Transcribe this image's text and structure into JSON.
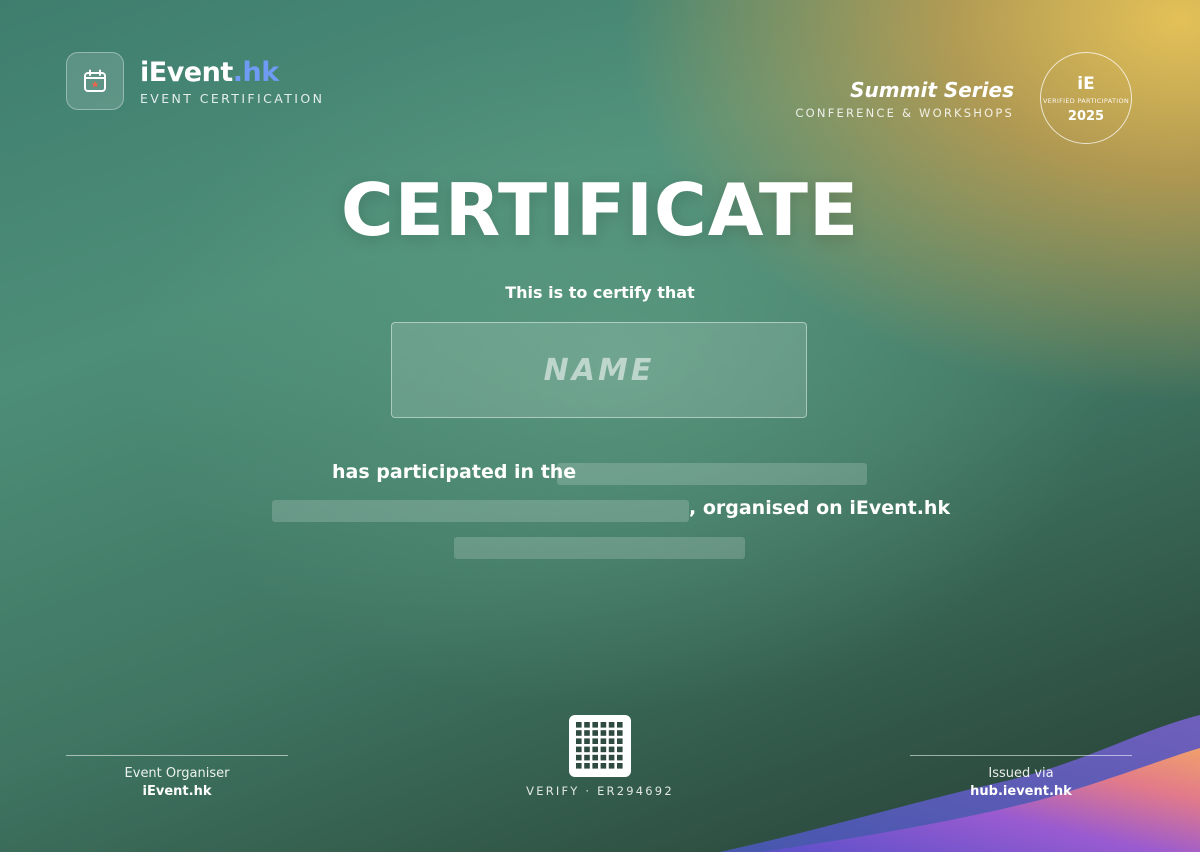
{
  "brand": {
    "name_main": "iEvent",
    "name_accent": ".hk",
    "subtitle": "EVENT CERTIFICATION",
    "logo_icon": "calendar-icon"
  },
  "series": {
    "title": "Summit Series",
    "subtitle": "CONFERENCE & WORKSHOPS"
  },
  "seal": {
    "logo": "iE",
    "text": "VERIFIED PARTICIPATION",
    "year": "2025"
  },
  "certificate": {
    "title": "CERTIFICATE",
    "intro": "This is to certify that",
    "name_placeholder": "NAME",
    "line1_prefix": "has participated in the",
    "line2_suffix": ", organised on iEvent.hk"
  },
  "footer": {
    "organiser_label": "Event Organiser",
    "organiser_value": "iEvent.hk",
    "verify_text": "VERIFY · ER294692",
    "issued_label": "Issued via",
    "issued_value": "hub.ievent.hk"
  },
  "colors": {
    "accent": "#6f9bf5",
    "icon_star": "#e0694e"
  }
}
